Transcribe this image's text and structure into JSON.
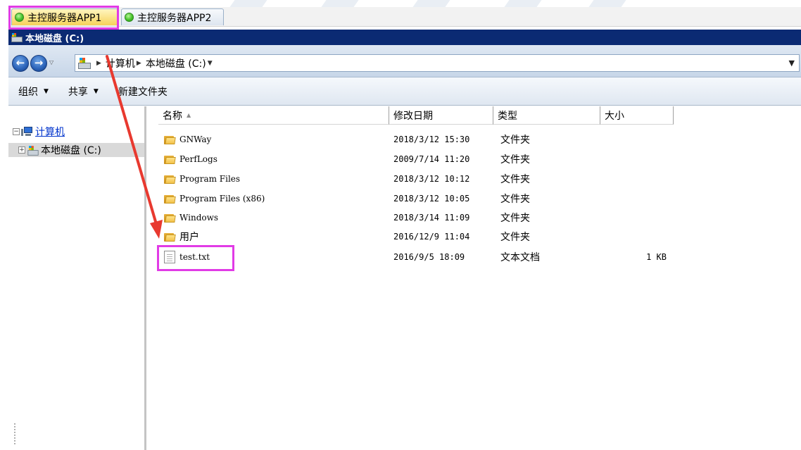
{
  "tabs": [
    {
      "label": "主控服务器APP1",
      "active": true
    },
    {
      "label": "主控服务器APP2",
      "active": false
    }
  ],
  "window": {
    "title": "本地磁盘 (C:)"
  },
  "address": {
    "crumbs": [
      "计算机",
      "本地磁盘 (C:)"
    ]
  },
  "toolbar": {
    "organize": "组织",
    "share": "共享",
    "new_folder": "新建文件夹"
  },
  "nav": {
    "computer": "计算机",
    "local_disk": "本地磁盘 (C:)"
  },
  "columns": {
    "name": "名称",
    "date": "修改日期",
    "type": "类型",
    "size": "大小"
  },
  "files": [
    {
      "name": "GNWay",
      "date": "2018/3/12 15:30",
      "type": "文件夹",
      "size": "",
      "kind": "folder-icon"
    },
    {
      "name": "PerfLogs",
      "date": "2009/7/14 11:20",
      "type": "文件夹",
      "size": "",
      "kind": "folder-icon"
    },
    {
      "name": "Program Files",
      "date": "2018/3/12 10:12",
      "type": "文件夹",
      "size": "",
      "kind": "folder-icon"
    },
    {
      "name": "Program Files (x86)",
      "date": "2018/3/12 10:05",
      "type": "文件夹",
      "size": "",
      "kind": "folder-icon"
    },
    {
      "name": "Windows",
      "date": "2018/3/14 11:09",
      "type": "文件夹",
      "size": "",
      "kind": "folder-icon"
    },
    {
      "name": "用户",
      "date": "2016/12/9 11:04",
      "type": "文件夹",
      "size": "",
      "kind": "folder-icon"
    },
    {
      "name": "test.txt",
      "date": "2016/9/5 18:09",
      "type": "文本文档",
      "size": "1 KB",
      "kind": "text-file-icon"
    }
  ],
  "colors": {
    "highlight": "#e13be6",
    "arrow": "#e8392f",
    "titlebar": "#0b2a73"
  }
}
